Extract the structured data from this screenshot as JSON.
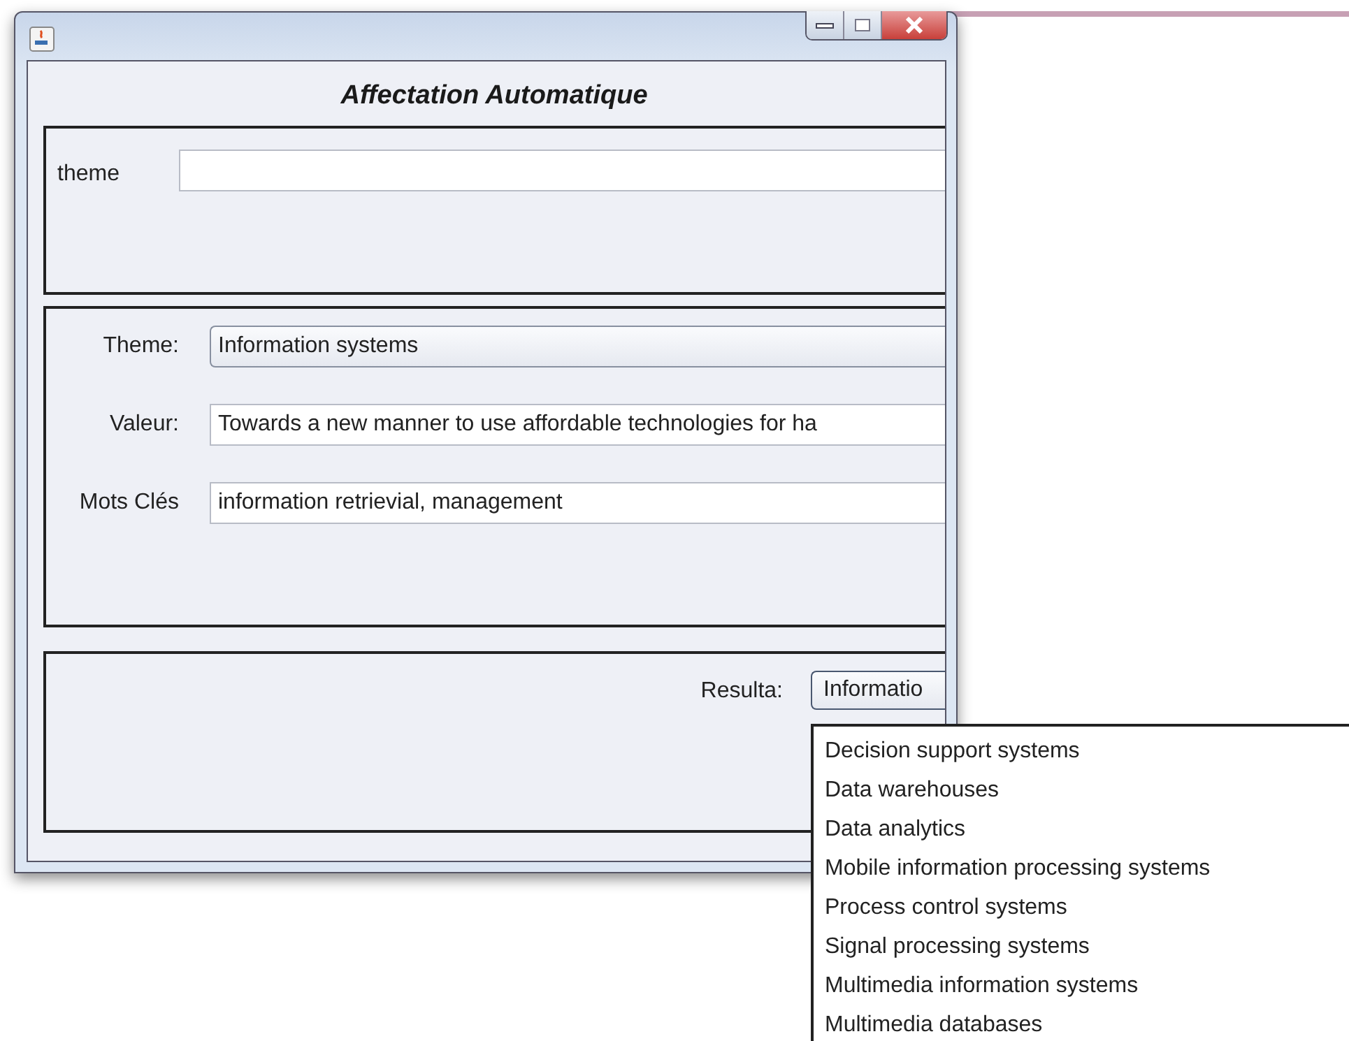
{
  "heading": "Affectation Automatique",
  "search_panel": {
    "label": "theme"
  },
  "details": [
    {
      "label": "Theme:",
      "value": "Information systems",
      "kind": "combo"
    },
    {
      "label": "Valeur:",
      "value": "Towards a new manner to use affordable technologies for ha",
      "kind": "text"
    },
    {
      "label": "Mots Clés",
      "value": "information retrievial, management",
      "kind": "text"
    }
  ],
  "result": {
    "label": "Resulta:",
    "value": "Informatio",
    "expanded": true,
    "options": [
      "Decision support systems",
      "Data warehouses",
      "Data analytics",
      "Mobile information processing systems",
      "Process control systems",
      "Signal processing systems",
      "Multimedia information systems",
      "Multimedia databases"
    ]
  }
}
